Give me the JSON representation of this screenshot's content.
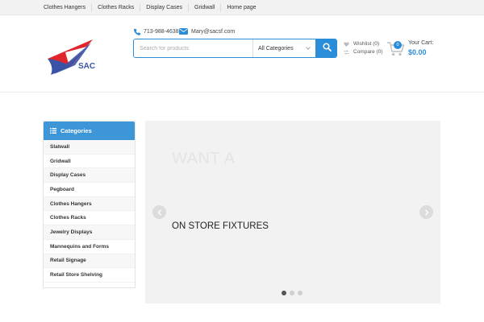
{
  "topnav": {
    "links": [
      "Clothes Hangers",
      "Clothes Racks",
      "Display Cases",
      "Gridwall",
      "Home page"
    ]
  },
  "header": {
    "logo_text": "SAC",
    "phone": "713-988-4638",
    "email": "Mary@sacsf.com",
    "search_placeholder": "Search for products",
    "category_selected": "All Categories",
    "wishlist": "Wishlist (0)",
    "compare": "Compare (0)",
    "cart_label": "Your Cart:",
    "cart_count": "0",
    "cart_total": "$0.00"
  },
  "sidebar": {
    "title": "Categories",
    "items": [
      "Slatwall",
      "Gridwall",
      "Display Cases",
      "Pegboard",
      "Clothes Hangers",
      "Clothes Racks",
      "Jewelry Displays",
      "Mannequins and Forms",
      "Retail Signage",
      "Retail Store Shelving"
    ]
  },
  "slider": {
    "headline": "WANT A",
    "subline": "ON STORE FIXTURES",
    "active_slide": 1,
    "slide_count": 3
  },
  "colors": {
    "accent": "#2b8dd8",
    "category_header": "#3d96d8",
    "logo_red": "#e0262c",
    "logo_blue": "#3a53a4"
  }
}
